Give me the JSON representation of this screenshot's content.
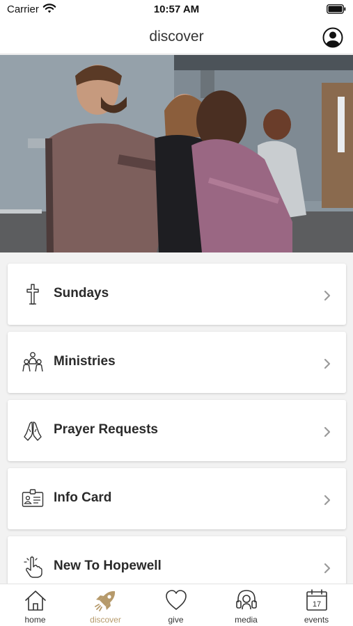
{
  "status_bar": {
    "carrier": "Carrier",
    "time": "10:57 AM"
  },
  "nav": {
    "title": "discover",
    "profile_icon": "user-circle-icon"
  },
  "hero": {
    "image": "photo-people-praying"
  },
  "menu": [
    {
      "label": "Sundays",
      "icon": "cross-icon"
    },
    {
      "label": "Ministries",
      "icon": "people-group-icon"
    },
    {
      "label": "Prayer Requests",
      "icon": "praying-hands-icon"
    },
    {
      "label": "Info Card",
      "icon": "id-card-icon"
    },
    {
      "label": "New To Hopewell",
      "icon": "tap-hand-icon"
    }
  ],
  "tabs": [
    {
      "label": "home",
      "icon": "home-icon",
      "active": false
    },
    {
      "label": "discover",
      "icon": "rocket-icon",
      "active": true
    },
    {
      "label": "give",
      "icon": "heart-icon",
      "active": false
    },
    {
      "label": "media",
      "icon": "headphones-icon",
      "active": false
    },
    {
      "label": "events",
      "icon": "calendar-icon",
      "active": false
    }
  ],
  "events_icon_day": "17",
  "colors": {
    "accent": "#b69a6b",
    "text": "#2a2a2a",
    "background": "#f2f2f2"
  }
}
